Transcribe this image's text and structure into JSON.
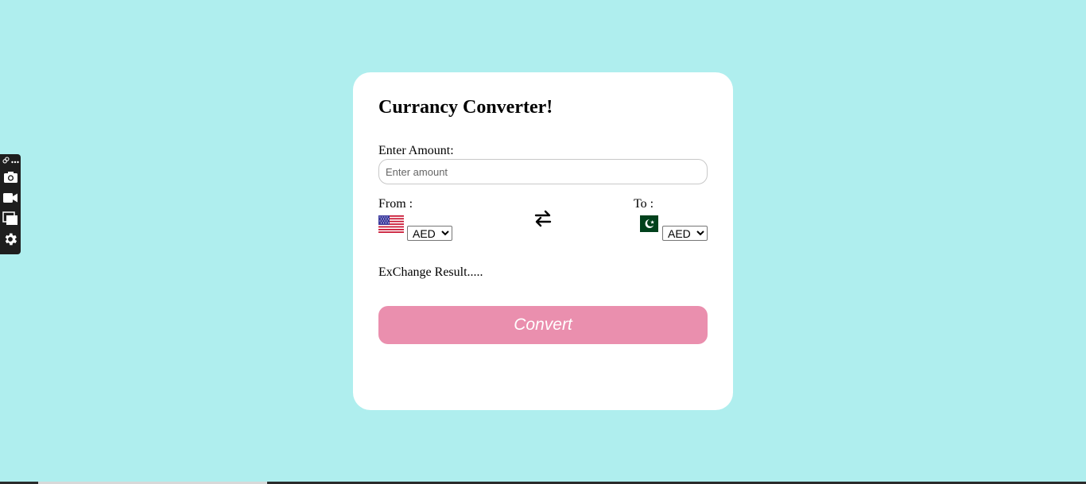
{
  "app": {
    "title": "Currancy Converter!"
  },
  "amount": {
    "label": "Enter Amount:",
    "value": "",
    "placeholder": "Enter amount"
  },
  "from": {
    "label": "From :",
    "flag": "us-flag-icon",
    "selected": "AED"
  },
  "to": {
    "label": "To :",
    "flag": "pk-flag-icon",
    "selected": "AED"
  },
  "swap": {
    "icon": "swap-arrows-icon"
  },
  "result": {
    "text": "ExChange Result....."
  },
  "convert": {
    "label": "Convert"
  },
  "colors": {
    "background": "#afeeee",
    "card": "#ffffff",
    "button": "#ea8fae",
    "toolbar": "#1e1e1e"
  },
  "toolbar": {
    "icons": [
      "link-icon",
      "more-icon",
      "camera-icon",
      "video-icon",
      "window-icon",
      "gear-icon"
    ]
  }
}
